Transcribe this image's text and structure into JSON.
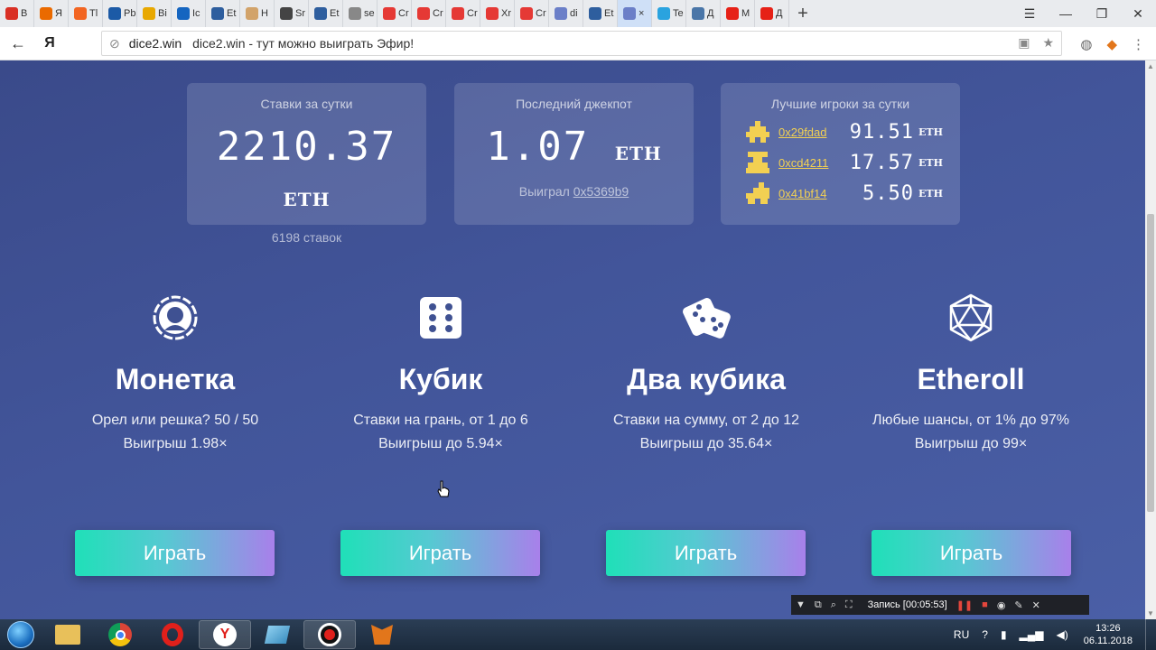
{
  "tabs": [
    {
      "label": "В",
      "color": "#d93025"
    },
    {
      "label": "Я",
      "color": "#ea6a00"
    },
    {
      "label": "Tl",
      "color": "#f26522"
    },
    {
      "label": "Pb A",
      "color": "#1c5aa6"
    },
    {
      "label": "Bi",
      "color": "#e8a800"
    },
    {
      "label": "Ic",
      "color": "#1565c0"
    },
    {
      "label": "Et",
      "color": "#2e5e9e"
    },
    {
      "label": "H",
      "color": "#d2a36a"
    },
    {
      "label": "Sr",
      "color": "#444444"
    },
    {
      "label": "Et",
      "color": "#2e5e9e"
    },
    {
      "label": "se",
      "color": "#888888"
    },
    {
      "label": "Cr",
      "color": "#e53935"
    },
    {
      "label": "Cr",
      "color": "#e53935"
    },
    {
      "label": "Cr",
      "color": "#e53935"
    },
    {
      "label": "Xr",
      "color": "#e53935"
    },
    {
      "label": "Cr",
      "color": "#e53935"
    },
    {
      "label": "di",
      "color": "#6b7fc8"
    },
    {
      "label": "Et",
      "color": "#2e5e9e"
    },
    {
      "label": "×",
      "color": "#6b7fc8"
    },
    {
      "label": "Te",
      "color": "#2aa3df"
    },
    {
      "label": "Д",
      "color": "#4a76a8"
    },
    {
      "label": "M",
      "color": "#e62117"
    },
    {
      "label": "Д",
      "color": "#e62117"
    }
  ],
  "browser": {
    "back_icon": "←",
    "yandex_label": "Я",
    "host": "dice2.win",
    "page_title": "dice2.win - тут можно выиграть Эфир!"
  },
  "stats": {
    "bets_label": "Ставки за сутки",
    "bets_value": "2210.37",
    "bets_unit": "ETH",
    "bets_count": "6198 ставок",
    "jackpot_label": "Последний джекпот",
    "jackpot_value": "1.07",
    "jackpot_unit": "ETH",
    "jackpot_won_prefix": "Выиграл ",
    "jackpot_winner": "0x5369b9",
    "top_label": "Лучшие игроки за сутки",
    "top_players": [
      {
        "address": "0x29fdad",
        "value": "91.51",
        "unit": "ETH"
      },
      {
        "address": "0xcd4211",
        "value": "17.57",
        "unit": "ETH"
      },
      {
        "address": "0x41bf14",
        "value": "5.50",
        "unit": "ETH"
      }
    ]
  },
  "games": [
    {
      "title": "Монетка",
      "desc1": "Орел или решка? 50 / 50",
      "desc2": "Выигрыш 1.98×",
      "button": "Играть",
      "icon": "coin-icon"
    },
    {
      "title": "Кубик",
      "desc1": "Ставки на грань, от 1 до 6",
      "desc2": "Выигрыш до 5.94×",
      "button": "Играть",
      "icon": "die-icon"
    },
    {
      "title": "Два кубика",
      "desc1": "Ставки на сумму, от 2 до 12",
      "desc2": "Выигрыш до 35.64×",
      "button": "Играть",
      "icon": "two-dice-icon"
    },
    {
      "title": "Etheroll",
      "desc1": "Любые шансы, от 1% до 97%",
      "desc2": "Выигрыш до 99×",
      "button": "Играть",
      "icon": "icosahedron-icon"
    }
  ],
  "recorder": {
    "status": "Запись [00:05:53]"
  },
  "taskbar": {
    "lang": "RU",
    "time": "13:26",
    "date": "06.11.2018"
  },
  "colors": {
    "accent_start": "#1fe0b8",
    "accent_end": "#a880ea",
    "player_link": "#f2d052",
    "page_bg": "#42559a"
  }
}
